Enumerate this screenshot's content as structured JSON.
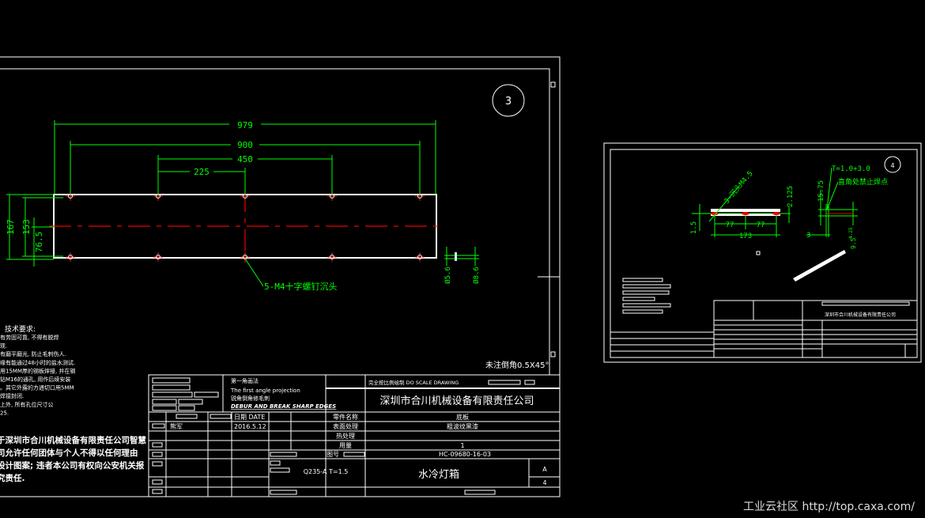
{
  "colors": {
    "background": "#000000",
    "geometry": "#ffffff",
    "dimension": "#00ff00",
    "centerline": "#ee0000"
  },
  "sheet3": {
    "sheet_number": "3",
    "dimensions": {
      "overall_length": "979",
      "hole_span": "900",
      "inner_span": "450",
      "half_span": "225",
      "height": "167",
      "hole_height": "153",
      "half_height": "76.5",
      "d1": "Ø5.6",
      "d2": "Ø8.6"
    },
    "callout": "5-M4十字螺钉沉头",
    "note": "未注倒角0.5X45°",
    "tech_title": "技术要求:",
    "tech_lines": [
      "有劳固可靠, 不得有脱焊",
      "现.",
      "有磨平磨光, 防止毛刺伤人.",
      "缘有能通过48小时的盐水测试.",
      "用15MM厚的钢板焊接, 并在钢",
      "钻M16的通孔, 用作后续安装",
      "。其它外露的方通切口用5MM",
      "焊接封闭.",
      "上外, 所有孔位尺寸公",
      "25."
    ],
    "copyright_lines": [
      "于深圳市合川机械设备有限责任公司智慧",
      "司允许任何团体与个人不得以任何理由",
      "设计图案; 违者本公司有权向公安机关报",
      "究责任."
    ],
    "title_block": {
      "projection_cn": "第一角画法",
      "projection_en": "The first angle projection",
      "deburr_cn": "锐角倒角修毛刺",
      "deburr_en": "DEBUR AND BREAK SHARP EDGES",
      "scale_note": "完全按比例绘制    DO  SCALE DRAWING",
      "company": "深圳市合川机械设备有限责任公司",
      "date_label": "日期 DATE",
      "designer": "熊军",
      "date": "2016.5.12",
      "part_name_label": "零件名称",
      "part_name": "底板",
      "surface_label": "表面处理",
      "surface": "粗波纹黑漆",
      "heat_label": "热处理",
      "qty_label": "用量",
      "qty": "1",
      "drawing_no_label": "图号",
      "drawing_no": "HC-09680-16-03",
      "material": "Q235-A T=1.5",
      "product": "水冷灯箱",
      "size": "A",
      "sheet": "4"
    }
  },
  "sheet4": {
    "sheet_number": "4",
    "dimensions": {
      "thickness": "1.5",
      "hole": "3-沉头M4.5",
      "offset": "2.125",
      "pitch1": "77",
      "pitch2": "77",
      "length": "173",
      "height": "15.75",
      "gap": "3",
      "depth": "9.5",
      "small": "4.25"
    },
    "note_t": "T=1.0+3.0",
    "note_weld": "直角处禁止焊点",
    "company": "深圳市合川机械设备有限责任公司"
  },
  "watermark": "工业云社区 http://top.caxa.com/"
}
